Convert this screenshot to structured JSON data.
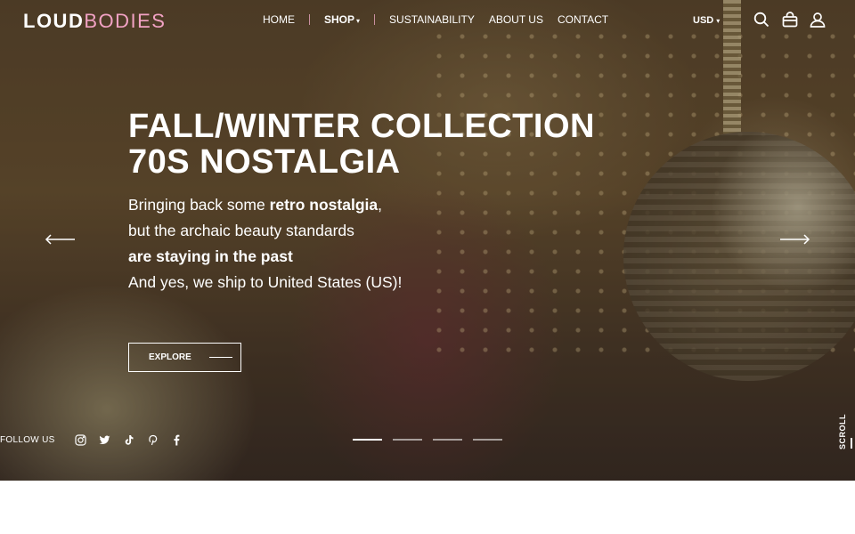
{
  "header": {
    "logo_bold": "LOUD",
    "logo_light": "BODIES",
    "nav": {
      "home": "HOME",
      "shop": "SHOP",
      "sustainability": "SUSTAINABILITY",
      "about": "ABOUT US",
      "contact": "CONTACT"
    },
    "currency": "USD",
    "icons": [
      "search-icon",
      "bag-icon",
      "user-icon"
    ]
  },
  "hero": {
    "headline_line1": "FALL/WINTER COLLECTION",
    "headline_line2": "70S NOSTALGIA",
    "sub_line1_pre": "Bringing back some ",
    "sub_line1_bold": "retro nostalgia",
    "sub_line1_post": ",",
    "sub_line2": "but the archaic beauty standards",
    "sub_line3_bold": "are staying in the past",
    "sub_line4": "And yes, we ship to United States (US)!",
    "cta_label": "EXPLORE",
    "prev_icon": "arrow-left-icon",
    "next_icon": "arrow-right-icon"
  },
  "footer_bar": {
    "follow_label": "FOLLOW US",
    "social": [
      "instagram-icon",
      "twitter-icon",
      "tiktok-icon",
      "pinterest-icon",
      "facebook-icon"
    ],
    "slide_count": 4,
    "active_slide": 1,
    "scroll_label": "SCROLL"
  },
  "colors": {
    "accent_pink": "#f2a2c4",
    "highlight_pink": "#d6578c",
    "text": "#ffffff"
  }
}
